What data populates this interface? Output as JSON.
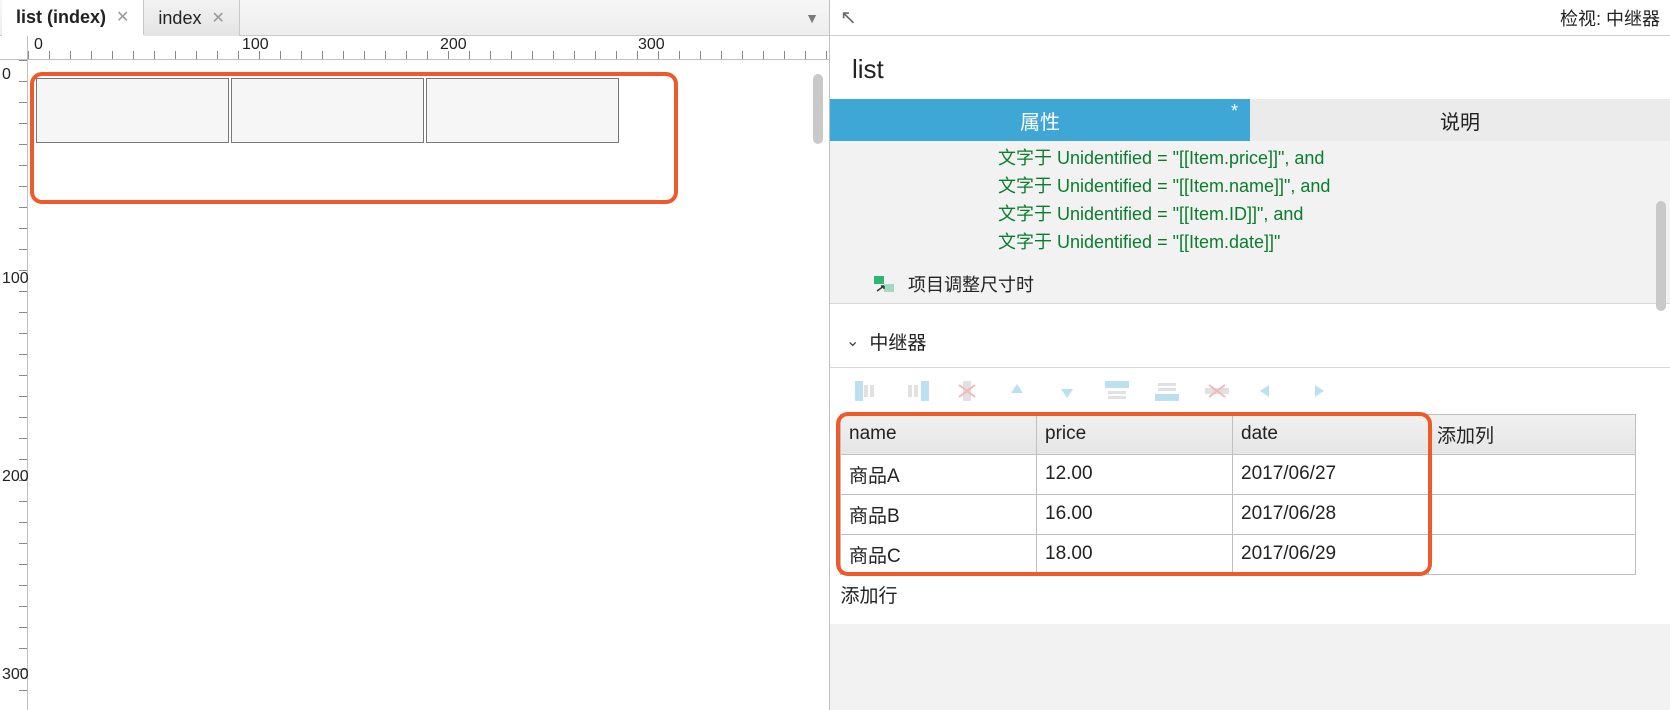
{
  "tabs": {
    "active": {
      "label": "list (index)"
    },
    "inactive": {
      "label": "index"
    }
  },
  "ruler": {
    "h": [
      "0",
      "100",
      "200",
      "300"
    ],
    "v": [
      "0",
      "100",
      "200",
      "300"
    ]
  },
  "inspector": {
    "header_label": "检视: 中继器",
    "widget_name": "list",
    "panel_tabs": {
      "active": "属性",
      "other": "说明"
    },
    "interactions": {
      "lines": [
        "文字于 Unidentified = \"[[Item.price]]\", and",
        "文字于 Unidentified = \"[[Item.name]]\", and",
        "文字于 Unidentified = \"[[Item.ID]]\", and",
        "文字于 Unidentified = \"[[Item.date]]\""
      ],
      "resize_label": "项目调整尺寸时"
    },
    "repeater_section": {
      "title": "中继器",
      "columns": [
        "name",
        "price",
        "date"
      ],
      "add_col": "添加列",
      "rows": [
        {
          "name": "商品A",
          "price": "12.00",
          "date": "2017/06/27"
        },
        {
          "name": "商品B",
          "price": "16.00",
          "date": "2017/06/28"
        },
        {
          "name": "商品C",
          "price": "18.00",
          "date": "2017/06/29"
        }
      ],
      "add_row": "添加行"
    }
  }
}
